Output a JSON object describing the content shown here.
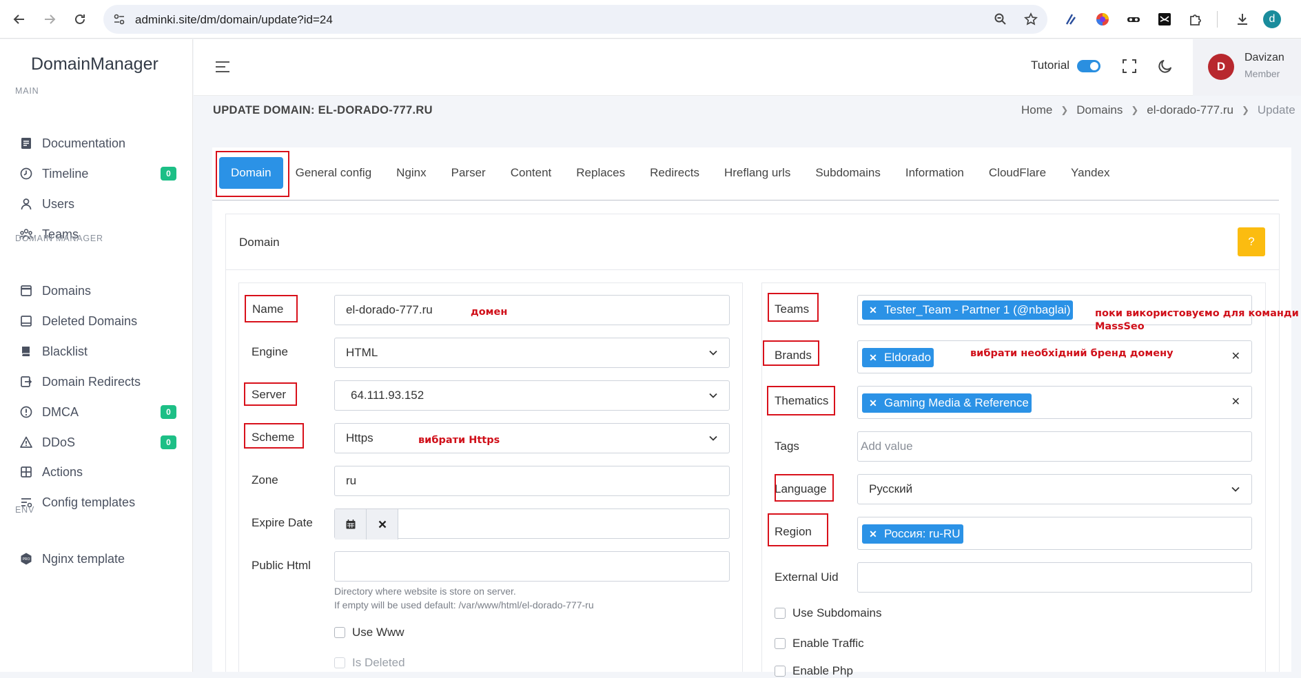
{
  "browser": {
    "url": "adminki.site/dm/domain/update?id=24",
    "profile_initial": "d"
  },
  "sidebar": {
    "brand": "DomainManager",
    "sections": {
      "main": "MAIN",
      "domain_manager": "DOMAIN MANAGER",
      "env": "ENV"
    },
    "items": [
      {
        "label": "Documentation",
        "icon": "document-icon"
      },
      {
        "label": "Timeline",
        "icon": "clock-icon",
        "badge": "0"
      },
      {
        "label": "Users",
        "icon": "user-icon"
      },
      {
        "label": "Teams",
        "icon": "team-icon"
      },
      {
        "label": "Domains",
        "icon": "window-icon"
      },
      {
        "label": "Deleted Domains",
        "icon": "trash-box-icon"
      },
      {
        "label": "Blacklist",
        "icon": "book-icon"
      },
      {
        "label": "Domain Redirects",
        "icon": "redirect-icon"
      },
      {
        "label": "DMCA",
        "icon": "alert-circle-icon",
        "badge": "0"
      },
      {
        "label": "DDoS",
        "icon": "warning-icon",
        "badge": "0"
      },
      {
        "label": "Actions",
        "icon": "grid-icon"
      },
      {
        "label": "Config templates",
        "icon": "sliders-icon"
      },
      {
        "label": "Nginx template",
        "icon": "nginx-icon"
      }
    ]
  },
  "topbar": {
    "tutorial_label": "Tutorial",
    "tutorial_on": true,
    "user": {
      "initial": "D",
      "name": "Davizan",
      "role": "Member"
    }
  },
  "page": {
    "title": "UPDATE DOMAIN: EL-DORADO-777.RU",
    "breadcrumb": [
      "Home",
      "Domains",
      "el-dorado-777.ru",
      "Update"
    ]
  },
  "tabs": [
    "Domain",
    "General config",
    "Nginx",
    "Parser",
    "Content",
    "Replaces",
    "Redirects",
    "Hreflang urls",
    "Subdomains",
    "Information",
    "CloudFlare",
    "Yandex"
  ],
  "card": {
    "title": "Domain",
    "help_label": "?"
  },
  "form_left": {
    "name": {
      "label": "Name",
      "value": "el-dorado-777.ru"
    },
    "engine": {
      "label": "Engine",
      "value": "HTML"
    },
    "server": {
      "label": "Server",
      "value": "64.111.93.152"
    },
    "scheme": {
      "label": "Scheme",
      "value": "Https"
    },
    "zone": {
      "label": "Zone",
      "value": "ru"
    },
    "expire_date": {
      "label": "Expire Date",
      "value": ""
    },
    "public_html": {
      "label": "Public Html",
      "value": "",
      "help1": "Directory where website is store on server.",
      "help2": "If empty will be used default: /var/www/html/el-dorado-777-ru"
    },
    "use_www": "Use Www",
    "is_deleted": "Is Deleted"
  },
  "form_right": {
    "teams": {
      "label": "Teams",
      "tag": "Tester_Team - Partner 1 (@nbaglai)"
    },
    "brands": {
      "label": "Brands",
      "tag": "Eldorado"
    },
    "thematics": {
      "label": "Thematics",
      "tag": "Gaming Media & Reference"
    },
    "tags": {
      "label": "Tags",
      "placeholder": "Add value"
    },
    "language": {
      "label": "Language",
      "value": "Русский"
    },
    "region": {
      "label": "Region",
      "tag": "Россия: ru-RU"
    },
    "external_uid": {
      "label": "External Uid",
      "value": ""
    },
    "use_subdomains": "Use Subdomains",
    "enable_traffic": "Enable Traffic",
    "enable_php": "Enable Php"
  },
  "annotations": {
    "name_note": "домен",
    "scheme_note": "вибрати Https",
    "teams_note_1": "поки використовуємо для команди",
    "teams_note_2": "MassSeo",
    "brands_note": "вибрати необхідний бренд домену"
  },
  "colors": {
    "primary": "#2b92e6",
    "badge": "#1dbf86",
    "help": "#fbbc10",
    "annotation": "#d8101a",
    "avatar": "#b8282e"
  }
}
